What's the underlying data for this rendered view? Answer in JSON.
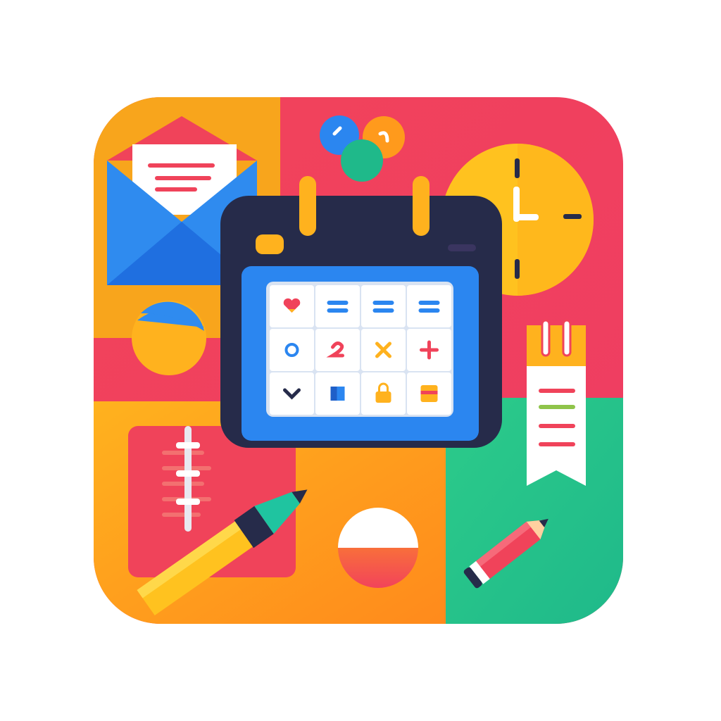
{
  "app_icon": {
    "subject": "calendar-planner-icon",
    "colors": {
      "orange": "#F8A51C",
      "orange_dark": "#FF8C1A",
      "red": "#F0415A",
      "green": "#27C48A",
      "navy": "#262B4A",
      "screen_blue": "#2B86F0",
      "envelope_blue": "#2F8BEF",
      "yellow": "#FFC21F",
      "white": "#FFFFFF"
    },
    "icons": [
      "calendar-icon",
      "envelope-icon",
      "coins-icon",
      "clock-icon",
      "ball-icon",
      "notebook-icon",
      "pen-icon",
      "half-circle-icon",
      "bookmark-icon",
      "pencil-icon"
    ],
    "calendar_cells": [
      "heart-icon",
      "equals-icon",
      "equals-icon",
      "equals-icon",
      "circle-icon",
      "two-icon",
      "cross-icon",
      "plus-icon",
      "chevron-down-icon",
      "square-icon",
      "lock-icon",
      "lines-icon"
    ]
  }
}
